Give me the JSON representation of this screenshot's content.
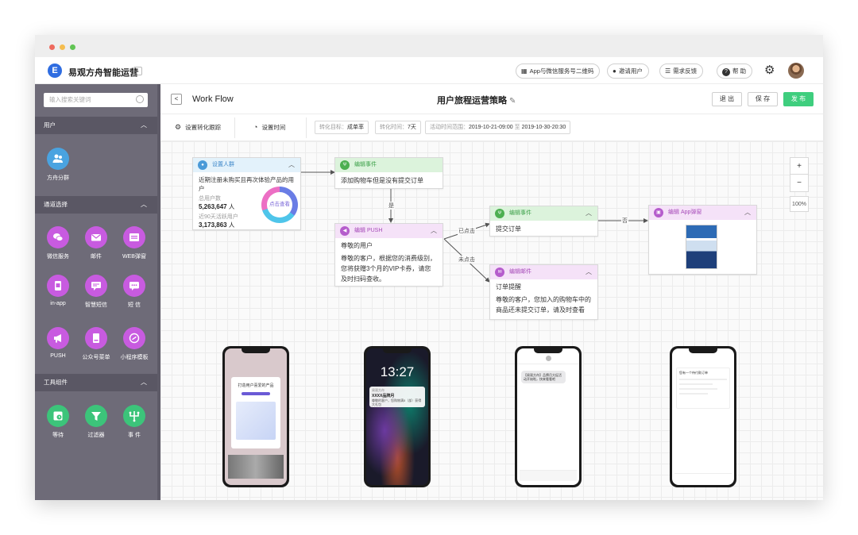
{
  "header": {
    "app_name": "易观方舟智能运营",
    "buttons": [
      {
        "label": "App与微信服务号二维码",
        "icon": "qrcode-icon"
      },
      {
        "label": "邀请用户",
        "icon": "user-icon"
      },
      {
        "label": "需求反馈",
        "icon": "edit-icon"
      },
      {
        "label": "帮 助",
        "icon": "help-icon"
      }
    ]
  },
  "sidebar": {
    "search_placeholder": "输入搜索关键词",
    "sections": [
      {
        "title": "用户",
        "items": [
          {
            "label": "方舟分群",
            "icon": "users-icon"
          }
        ]
      },
      {
        "title": "通道选择",
        "items": [
          {
            "label": "微信服务",
            "icon": "wechat-icon"
          },
          {
            "label": "邮件",
            "icon": "mail-icon"
          },
          {
            "label": "WEB弹窗",
            "icon": "web-popup-icon"
          },
          {
            "label": "in-app",
            "icon": "in-app-icon"
          },
          {
            "label": "智慧短信",
            "icon": "sms-icon"
          },
          {
            "label": "短 信",
            "icon": "message-icon"
          },
          {
            "label": "PUSH",
            "icon": "push-icon"
          },
          {
            "label": "公众号菜单",
            "icon": "menu-icon"
          },
          {
            "label": "小程序模板",
            "icon": "miniprogram-icon"
          }
        ]
      },
      {
        "title": "工具组件",
        "items": [
          {
            "label": "等待",
            "icon": "wait-icon"
          },
          {
            "label": "过滤器",
            "icon": "filter-icon"
          },
          {
            "label": "事 件",
            "icon": "event-icon"
          }
        ]
      }
    ],
    "colors": {
      "channel": "#c85be0",
      "tool": "#3cc47a",
      "user": "#4aa3e0"
    }
  },
  "toolbar": {
    "back_label": "<",
    "workflow_label": "Work Flow",
    "journey_title": "用户旅程运营策略",
    "exit_label": "退 出",
    "save_label": "保 存",
    "publish_label": "发 布",
    "publish_color": "#3fce7e"
  },
  "settings": {
    "conversion_track": "设置转化跟踪",
    "set_time": "设置时间",
    "goal_label": "转化目标：",
    "goal_value": "成单率",
    "time_label": "转化时间：",
    "time_value": "7天",
    "range_label": "活动时间范围：",
    "range_start": "2019-10-21-09:00",
    "range_to": "至",
    "range_end": "2019-10-30-20:30"
  },
  "flow": {
    "audience": {
      "header": "设置人群",
      "desc": "近期注册未购买且再次体验产品的用户",
      "total_label": "总用户数",
      "total_value": "5,263,647",
      "active_label": "近90天活跃用户",
      "active_value": "3,173,863",
      "unit": "人",
      "donut_label": "点击查看"
    },
    "event1": {
      "header": "编辑事件",
      "body": "添加购物车但是没有提交订单"
    },
    "push": {
      "header": "编辑 PUSH",
      "title": "尊敬的用户",
      "body": "尊敬的客户，根据您的消费级别，您将获赠3个月的VIP卡券，请您及时扫码查收。"
    },
    "event2": {
      "header": "编辑事件",
      "body": "提交订单"
    },
    "email": {
      "header": "编辑邮件",
      "title": "订单提醒",
      "body": "尊敬的客户，您加入的购物车中的商品还未提交订单，请及时查看"
    },
    "app_popup": {
      "header": "编辑 App弹窗"
    },
    "edge_labels": {
      "yes": "是",
      "submitted": "已点击",
      "not_clicked": "未点击",
      "no": "否"
    }
  },
  "zoom": {
    "plus": "+",
    "minus": "−",
    "level": "100%"
  },
  "phones": {
    "p1_title": "打造用户喜爱的产品",
    "p2_time": "13:27",
    "p2_notif_app": "易观方舟",
    "p2_notif_title": "XXXX品牌月",
    "p2_notif_body": "尊敬的客户，您购物满5（部）获得大礼包",
    "p3_bubble": "【易观方舟】品牌月大促活动开始啦，快来看看吧",
    "p4_text": "您有一个待付款订单"
  }
}
